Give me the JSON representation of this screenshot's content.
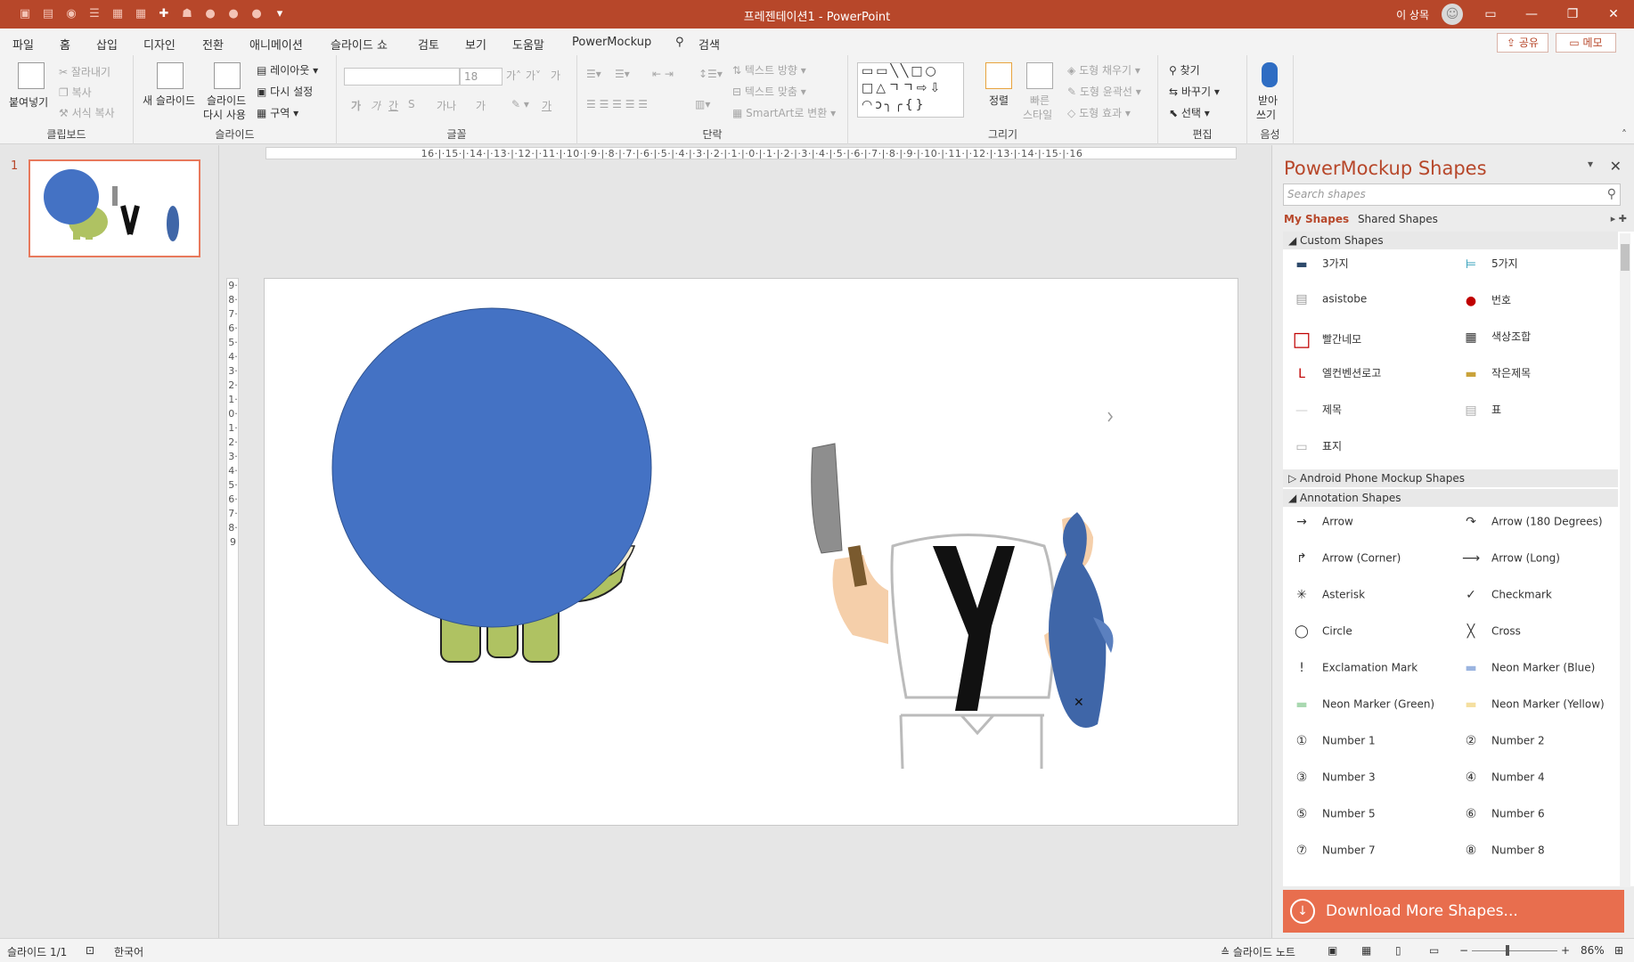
{
  "app": {
    "title": "프레젠테이션1  -  PowerPoint",
    "user": "이 상목",
    "avatar_icon": "person-icon",
    "qat_icons": [
      "undo-icon",
      "redo-icon",
      "shape-icon",
      "list-icon",
      "table-icon",
      "grid-icon",
      "plus-icon",
      "chart-icon",
      "circle-icon",
      "circle-icon",
      "circle-icon",
      "chevron-down-icon"
    ],
    "window_buttons": [
      "ribbon-display-icon",
      "minimize-icon",
      "restore-icon",
      "close-icon"
    ]
  },
  "menu": {
    "tabs": [
      "파일",
      "홈",
      "삽입",
      "디자인",
      "전환",
      "애니메이션",
      "슬라이드 쇼",
      "검토",
      "보기",
      "도움말",
      "PowerMockup",
      "검색"
    ],
    "active_tab": "홈",
    "share_label": "공유",
    "memo_label": "메모"
  },
  "ribbon": {
    "clipboard": {
      "label": "클립보드",
      "paste": "붙여넣기",
      "cut": "잘라내기",
      "copy": "복사",
      "format_painter": "서식 복사"
    },
    "slides": {
      "label": "슬라이드",
      "new_slide": "새 슬라이드",
      "reuse_slide_1": "슬라이드",
      "reuse_slide_2": "다시 사용",
      "layout": "레이아웃",
      "reset": "다시 설정",
      "section": "구역"
    },
    "font": {
      "label": "글꼴",
      "font_name": "",
      "font_size": "18",
      "grow": "가˄",
      "shrink": "가˅",
      "clear": "가",
      "bold": "가",
      "italic": "가",
      "underline": "간",
      "strike": "S",
      "spacing": "가나",
      "case": "가",
      "highlight": "가"
    },
    "paragraph": {
      "label": "단락",
      "text_direction": "텍스트 방향",
      "align_text": "텍스트 맞춤",
      "smartart": "SmartArt로 변환"
    },
    "drawing": {
      "label": "그리기",
      "shapes_preview": "▭▭╲╲□○\n□△ㄱㄱ⇨⇩\n◠ↄ╮╭{}",
      "arrange_1": "정렬",
      "quick_styles_1": "빠른",
      "quick_styles_2": "스타일",
      "shape_fill": "도형 채우기",
      "shape_outline": "도형 윤곽선",
      "shape_effect": "도형 효과"
    },
    "editing": {
      "label": "편집",
      "find": "찾기",
      "replace": "바꾸기",
      "select": "선택"
    },
    "voice": {
      "label": "음성",
      "dictate_1": "받아",
      "dictate_2": "쓰기"
    }
  },
  "thumbnails": {
    "slide_number": "1"
  },
  "ruler": {
    "horizontal": "16·|·15·|·14·|·13·|·12·|·11·|·10·|·9·|·8·|·7·|·6·|·5·|·4·|·3·|·2·|·1·|·0·|·1·|·2·|·3·|·4·|·5·|·6·|·7·|·8·|·9·|·10·|·11·|·12·|·13·|·14·|·15·|·16",
    "vertical": "9·8·7·6·5·4·3·2·1·0·1·2·3·4·5·6·7·8·9"
  },
  "slide": {
    "fill_colors": {
      "blue_circle": "#4472c4",
      "dino_green": "#afc262",
      "fish_blue": "#3f66a8",
      "skin": "#f5cfaa",
      "knife": "#8e8e8e",
      "black": "#111111"
    },
    "y_glyph": "y"
  },
  "pane": {
    "title": "PowerMockup Shapes",
    "close_icon": "close-icon",
    "dropdown_icon": "chevron-down-icon",
    "search_placeholder": "Search shapes",
    "tabs": {
      "my_shapes": "My Shapes",
      "shared_shapes": "Shared Shapes"
    },
    "sections": [
      {
        "title": "Custom Shapes",
        "expanded": true,
        "items": [
          {
            "label": "3가지",
            "icon": "toolbar-icon"
          },
          {
            "label": "5가지",
            "icon": "connector-icon"
          },
          {
            "label": "asistobe",
            "icon": "table-icon"
          },
          {
            "label": "번호",
            "icon": "number-badge-icon"
          },
          {
            "label": "빨간네모",
            "icon": "red-square-icon"
          },
          {
            "label": "색상조합",
            "icon": "palette-icon"
          },
          {
            "label": "엘컨벤션로고",
            "icon": "logo-icon"
          },
          {
            "label": "작은제목",
            "icon": "bar-icon"
          },
          {
            "label": "제목",
            "icon": "line-icon"
          },
          {
            "label": "표",
            "icon": "document-icon"
          },
          {
            "label": "표지",
            "icon": "cover-icon"
          }
        ]
      },
      {
        "title": "Android Phone Mockup Shapes",
        "expanded": false,
        "items": []
      },
      {
        "title": "Annotation Shapes",
        "expanded": true,
        "items": [
          {
            "label": "Arrow",
            "icon": "arrow-icon"
          },
          {
            "label": "Arrow (180 Degrees)",
            "icon": "arrow-180-icon"
          },
          {
            "label": "Arrow (Corner)",
            "icon": "arrow-corner-icon"
          },
          {
            "label": "Arrow (Long)",
            "icon": "arrow-long-icon"
          },
          {
            "label": "Asterisk",
            "icon": "asterisk-icon"
          },
          {
            "label": "Checkmark",
            "icon": "checkmark-icon"
          },
          {
            "label": "Circle",
            "icon": "circle-icon"
          },
          {
            "label": "Cross",
            "icon": "cross-icon"
          },
          {
            "label": "Exclamation Mark",
            "icon": "exclamation-icon"
          },
          {
            "label": "Neon Marker (Blue)",
            "icon": "marker-blue-icon"
          },
          {
            "label": "Neon Marker (Green)",
            "icon": "marker-green-icon"
          },
          {
            "label": "Neon Marker (Yellow)",
            "icon": "marker-yellow-icon"
          },
          {
            "label": "Number 1",
            "icon": "number-1-icon"
          },
          {
            "label": "Number 2",
            "icon": "number-2-icon"
          },
          {
            "label": "Number 3",
            "icon": "number-3-icon"
          },
          {
            "label": "Number 4",
            "icon": "number-4-icon"
          },
          {
            "label": "Number 5",
            "icon": "number-5-icon"
          },
          {
            "label": "Number 6",
            "icon": "number-6-icon"
          },
          {
            "label": "Number 7",
            "icon": "number-7-icon"
          },
          {
            "label": "Number 8",
            "icon": "number-8-icon"
          }
        ]
      }
    ],
    "download_label": "Download More Shapes..."
  },
  "status": {
    "slide_count": "슬라이드 1/1",
    "language": "한국어",
    "notes": "슬라이드 노트",
    "zoom": "86%"
  }
}
